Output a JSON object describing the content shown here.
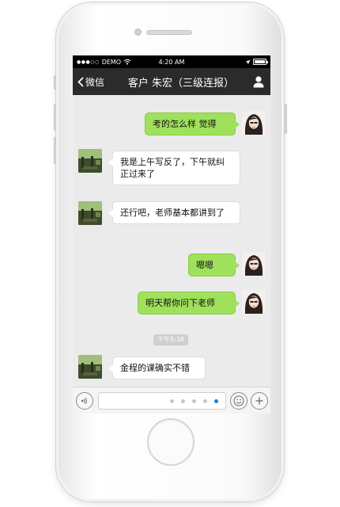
{
  "status_bar": {
    "carrier": "DEMO",
    "time": "4:20 AM",
    "battery_level": 1.0
  },
  "nav": {
    "back_label": "微信",
    "title": "客户 朱宏（三级连报）",
    "back_icon": "chevron-left-icon",
    "profile_icon": "person-icon"
  },
  "messages": [
    {
      "side": "out",
      "text": "考的怎么样 觉得"
    },
    {
      "side": "in",
      "text": "我是上午写反了，下午就纠正过来了"
    },
    {
      "side": "in",
      "text": "还行吧，老师基本都讲到了"
    },
    {
      "side": "out",
      "text": "嗯嗯"
    },
    {
      "side": "out",
      "text": "明天帮你问下老师"
    },
    {
      "side": "in",
      "text": "金程的课确实不错"
    }
  ],
  "timestamp": "下午5:38",
  "input_bar": {
    "voice_icon": "voice-icon",
    "emoji_icon": "emoji-icon",
    "plus_icon": "plus-icon",
    "page_count": 5,
    "active_page": 5
  },
  "colors": {
    "out_bubble": "#9fe15b",
    "in_bubble": "#ffffff",
    "nav_bg": "#2b2b2b",
    "chat_bg": "#ebebeb",
    "active_dot": "#1a7fd6"
  }
}
